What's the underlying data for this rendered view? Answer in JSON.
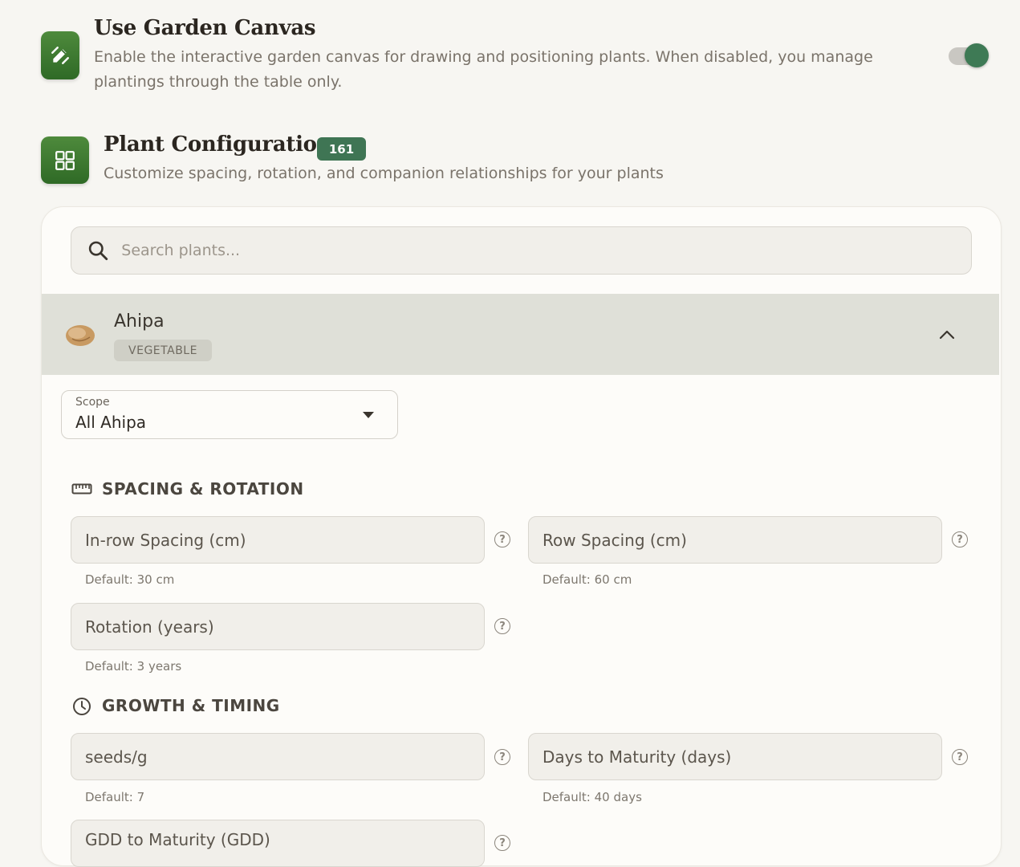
{
  "canvas_setting": {
    "title": "Use Garden Canvas",
    "description": "Enable the interactive garden canvas for drawing and positioning plants. When disabled, you manage plantings through the table only.",
    "toggle_on": true
  },
  "plant_config": {
    "title": "Plant Configuration",
    "count": "161",
    "subtitle": "Customize spacing, rotation, and companion relationships for your plants"
  },
  "search": {
    "placeholder": "Search plants..."
  },
  "selected_plant": {
    "name": "Ahipa",
    "category": "VEGETABLE"
  },
  "scope": {
    "label": "Scope",
    "value": "All Ahipa"
  },
  "sections": {
    "spacing": {
      "title": "SPACING & ROTATION",
      "in_row": {
        "label": "In-row Spacing (cm)",
        "hint": "Default: 30 cm"
      },
      "row": {
        "label": "Row Spacing (cm)",
        "hint": "Default: 60 cm"
      },
      "rotation": {
        "label": "Rotation (years)",
        "hint": "Default: 3 years"
      }
    },
    "growth": {
      "title": "GROWTH & TIMING",
      "seeds": {
        "label": "seeds/g",
        "hint": "Default: 7"
      },
      "maturity": {
        "label": "Days to Maturity (days)",
        "hint": "Default: 40 days"
      },
      "gdd": {
        "label": "GDD to Maturity (GDD)"
      }
    }
  },
  "colors": {
    "accent": "#3f7554",
    "icon_green": "#3d7a2e"
  },
  "icons": [
    "pencil-icon",
    "grid-icon",
    "search-icon",
    "chevron-up-icon",
    "caret-down-icon",
    "ruler-icon",
    "clock-icon",
    "help-icon"
  ]
}
